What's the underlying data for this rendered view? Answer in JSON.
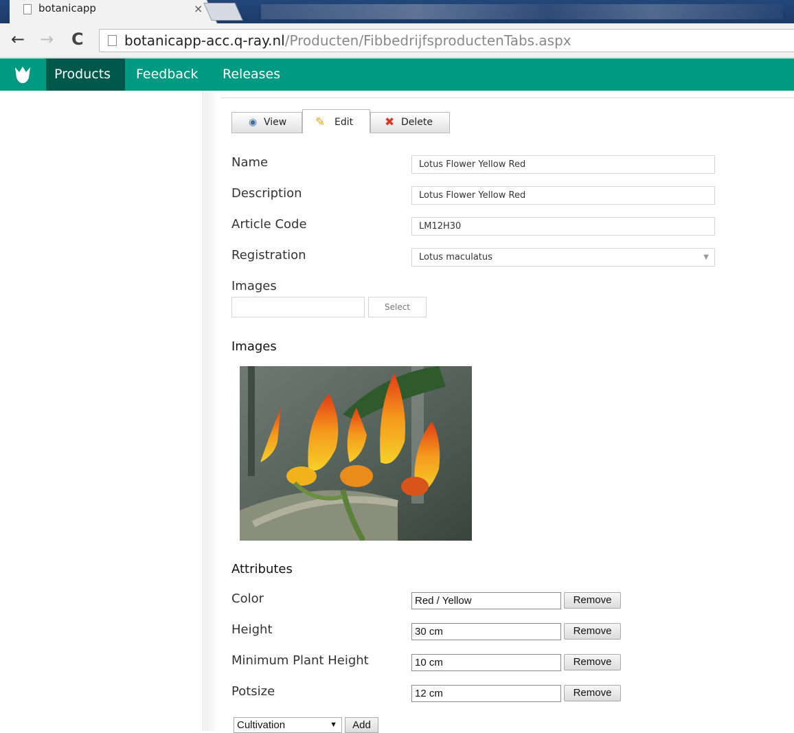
{
  "browser": {
    "tab_title": "botanicapp",
    "tab_close": "×",
    "url_host": "botanicapp-acc.q-ray.nl",
    "url_path": "/Producten/FibbedrijfsproductenTabs.aspx",
    "back_glyph": "←",
    "forward_glyph": "→",
    "reload_glyph": "C"
  },
  "appnav": {
    "brand_color": "#009a82",
    "active_color": "#00584a",
    "items": [
      {
        "label": "Products",
        "active": true
      },
      {
        "label": "Feedback",
        "active": false
      },
      {
        "label": "Releases",
        "active": false
      }
    ]
  },
  "tabs": {
    "view": {
      "label": "View",
      "icon": "eye-icon"
    },
    "edit": {
      "label": "Edit",
      "icon": "pencil-icon",
      "active": true
    },
    "delete": {
      "label": "Delete",
      "icon": "x-icon"
    }
  },
  "form": {
    "name": {
      "label": "Name",
      "value": "Lotus Flower Yellow Red"
    },
    "description": {
      "label": "Description",
      "value": "Lotus Flower Yellow Red"
    },
    "article_code": {
      "label": "Article Code",
      "value": "LM12H30"
    },
    "registration": {
      "label": "Registration",
      "value": "Lotus maculatus"
    },
    "images": {
      "label": "Images",
      "select_label": "Select"
    }
  },
  "images_section": {
    "title": "Images",
    "photo": "lotus-flower-photo"
  },
  "attributes": {
    "title": "Attributes",
    "remove_label": "Remove",
    "items": [
      {
        "label": "Color",
        "value": "Red / Yellow"
      },
      {
        "label": "Height",
        "value": "30 cm"
      },
      {
        "label": "Minimum Plant Height",
        "value": "10 cm"
      },
      {
        "label": "Potsize",
        "value": "12 cm"
      }
    ],
    "add_select": {
      "value": "Cultivation",
      "arrow": "▼"
    },
    "add_label": "Add"
  }
}
